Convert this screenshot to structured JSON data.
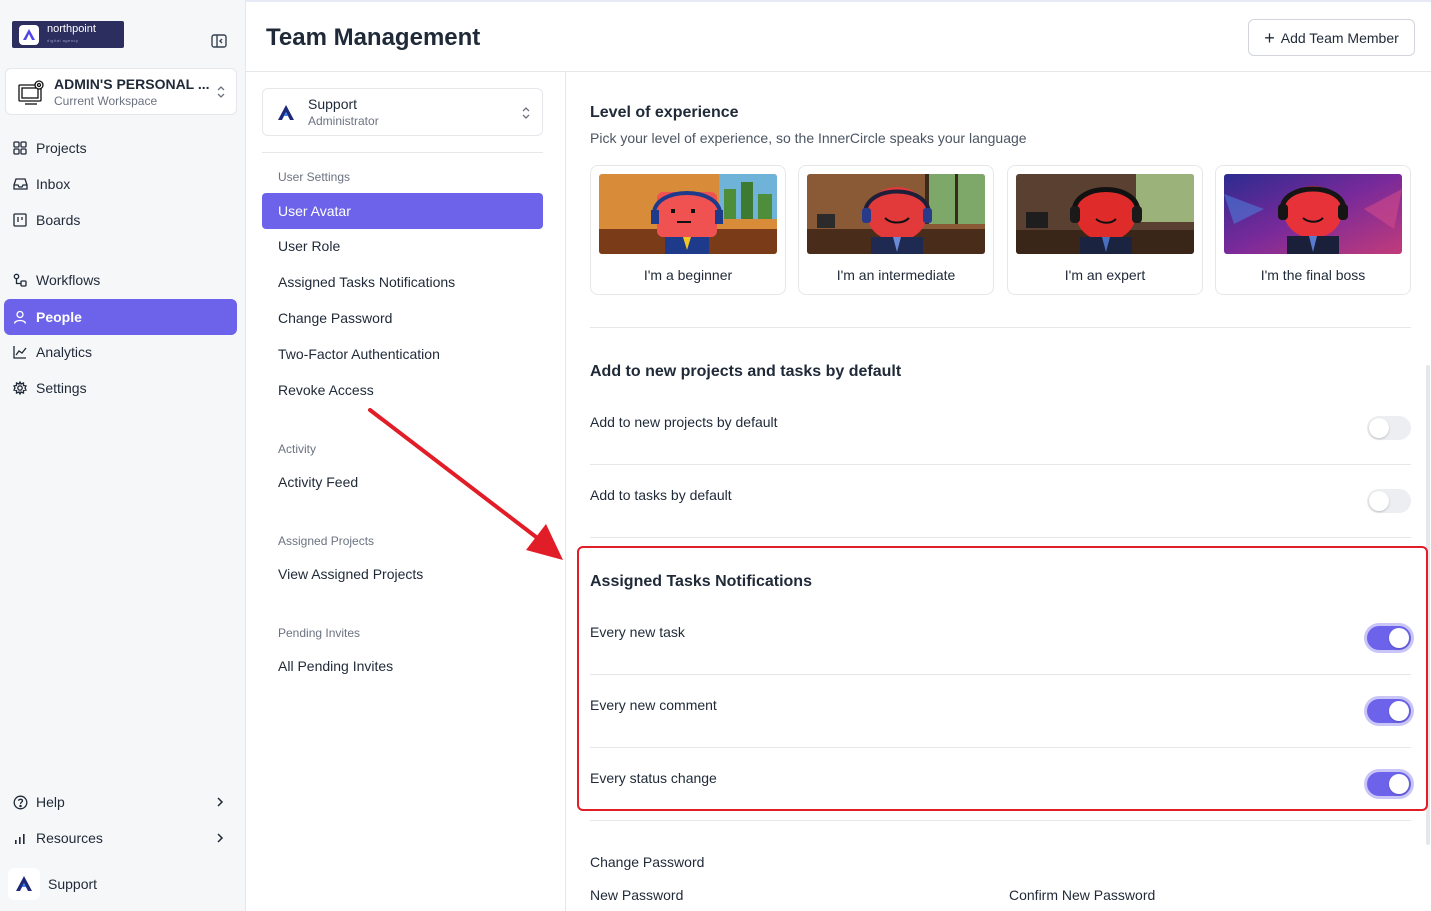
{
  "brand": {
    "name": "northpoint",
    "tagline": "digital agency"
  },
  "workspace": {
    "name": "ADMIN'S PERSONAL ...",
    "subtitle": "Current Workspace"
  },
  "sidebar": {
    "items": [
      {
        "label": "Projects",
        "icon": "grid-icon"
      },
      {
        "label": "Inbox",
        "icon": "inbox-icon"
      },
      {
        "label": "Boards",
        "icon": "board-icon"
      },
      {
        "label": "Workflows",
        "icon": "workflow-icon"
      },
      {
        "label": "People",
        "icon": "person-icon",
        "active": true
      },
      {
        "label": "Analytics",
        "icon": "chart-icon"
      },
      {
        "label": "Settings",
        "icon": "gear-icon"
      }
    ],
    "bottom": [
      {
        "label": "Help",
        "icon": "help-icon"
      },
      {
        "label": "Resources",
        "icon": "bars-icon"
      }
    ],
    "user": "Support"
  },
  "header": {
    "title": "Team Management",
    "add_button": "Add Team Member"
  },
  "team_select": {
    "name": "Support",
    "role": "Administrator"
  },
  "subnav": {
    "user_settings": {
      "label": "User Settings",
      "items": [
        "User Avatar",
        "User Role",
        "Assigned Tasks Notifications",
        "Change Password",
        "Two-Factor Authentication",
        "Revoke Access"
      ]
    },
    "activity": {
      "label": "Activity",
      "items": [
        "Activity Feed"
      ]
    },
    "assigned_projects": {
      "label": "Assigned Projects",
      "items": [
        "View Assigned Projects"
      ]
    },
    "pending_invites": {
      "label": "Pending Invites",
      "items": [
        "All Pending Invites"
      ]
    }
  },
  "experience": {
    "title": "Level of experience",
    "description": "Pick your level of experience, so the InnerCircle speaks your language",
    "options": [
      "I'm a beginner",
      "I'm an intermediate",
      "I'm an expert",
      "I'm the final boss"
    ]
  },
  "defaults": {
    "title": "Add to new projects and tasks by default",
    "rows": [
      {
        "label": "Add to new projects by default",
        "enabled": false
      },
      {
        "label": "Add to tasks by default",
        "enabled": false
      }
    ]
  },
  "notifications": {
    "title": "Assigned Tasks Notifications",
    "rows": [
      {
        "label": "Every new task",
        "enabled": true
      },
      {
        "label": "Every new comment",
        "enabled": true
      },
      {
        "label": "Every status change",
        "enabled": true
      }
    ]
  },
  "password": {
    "title": "Change Password",
    "new_label": "New Password",
    "confirm_label": "Confirm New Password"
  },
  "colors": {
    "accent": "#6c63ea",
    "highlight": "#e11d27",
    "sidebar_bg": "#f6f7f9"
  }
}
